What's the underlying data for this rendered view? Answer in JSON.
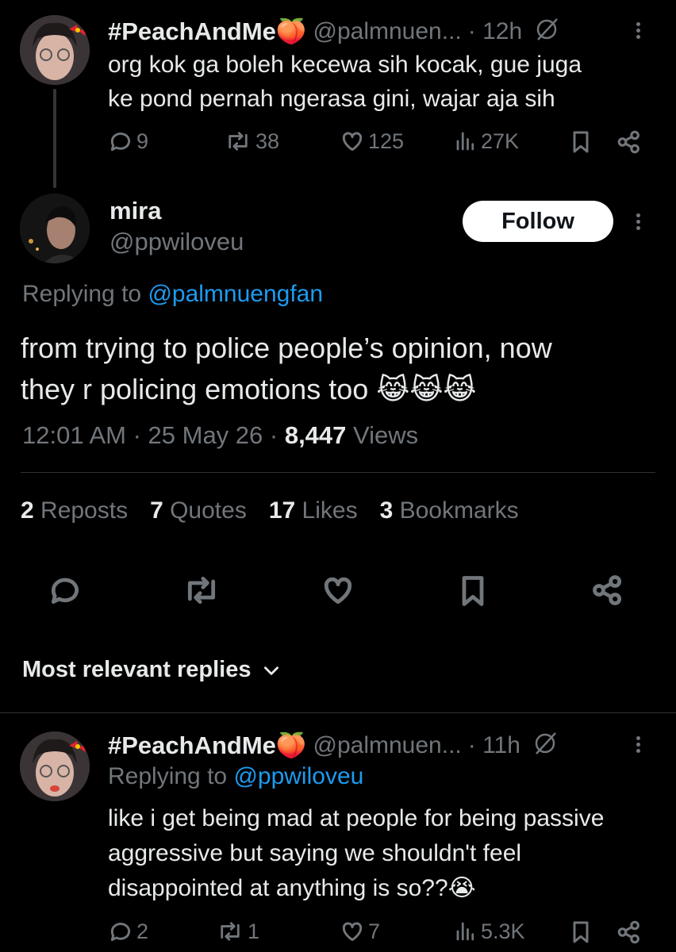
{
  "first_post": {
    "display_name": "#PeachAndMe",
    "name_emoji": "🍑",
    "handle": "@palmnuen...",
    "time": "· 12h",
    "text_line1": "org kok ga boleh kecewa sih kocak, gue juga",
    "text_line2": "ke pond pernah ngerasa gini, wajar aja sih",
    "replies": "9",
    "reposts": "38",
    "likes": "125",
    "views": "27K"
  },
  "main_post": {
    "display_name": "mira",
    "handle": "@ppwiloveu",
    "follow_label": "Follow",
    "replying_prefix": "Replying to ",
    "replying_handle": "@palmnuengfan",
    "text_line1": "from trying to police people’s opinion, now",
    "text_line2": "they r policing emotions too",
    "text_emoji": "😹😹😹",
    "timestamp": "12:01 AM · 25 May 26 · ",
    "views_count": "8,447",
    "views_label": " Views",
    "stats": {
      "reposts_count": "2",
      "reposts_label": " Reposts",
      "quotes_count": "7",
      "quotes_label": " Quotes",
      "likes_count": "17",
      "likes_label": " Likes",
      "bookmarks_count": "3",
      "bookmarks_label": " Bookmarks"
    }
  },
  "replies_filter": {
    "label": "Most relevant replies"
  },
  "reply_post": {
    "display_name": "#PeachAndMe",
    "name_emoji": "🍑",
    "handle": "@palmnuen...",
    "time": "· 11h",
    "replying_prefix": "Replying to ",
    "replying_handle": "@ppwiloveu",
    "text_line1": "like i get being mad at people for being passive",
    "text_line2": "aggressive but saying we shouldn't feel",
    "text_line3": "disappointed at anything is so??",
    "text_emoji": "😭",
    "replies": "2",
    "reposts": "1",
    "likes": "7",
    "views": "5.3K"
  },
  "colors": {
    "background": "#000000",
    "text": "#e7e9ea",
    "muted": "#71767b",
    "link": "#1d9bf0"
  },
  "icons": [
    "reply-icon",
    "repost-icon",
    "like-icon",
    "views-icon",
    "bookmark-icon",
    "share-icon",
    "grok-icon",
    "more-icon",
    "chevron-down-icon"
  ]
}
